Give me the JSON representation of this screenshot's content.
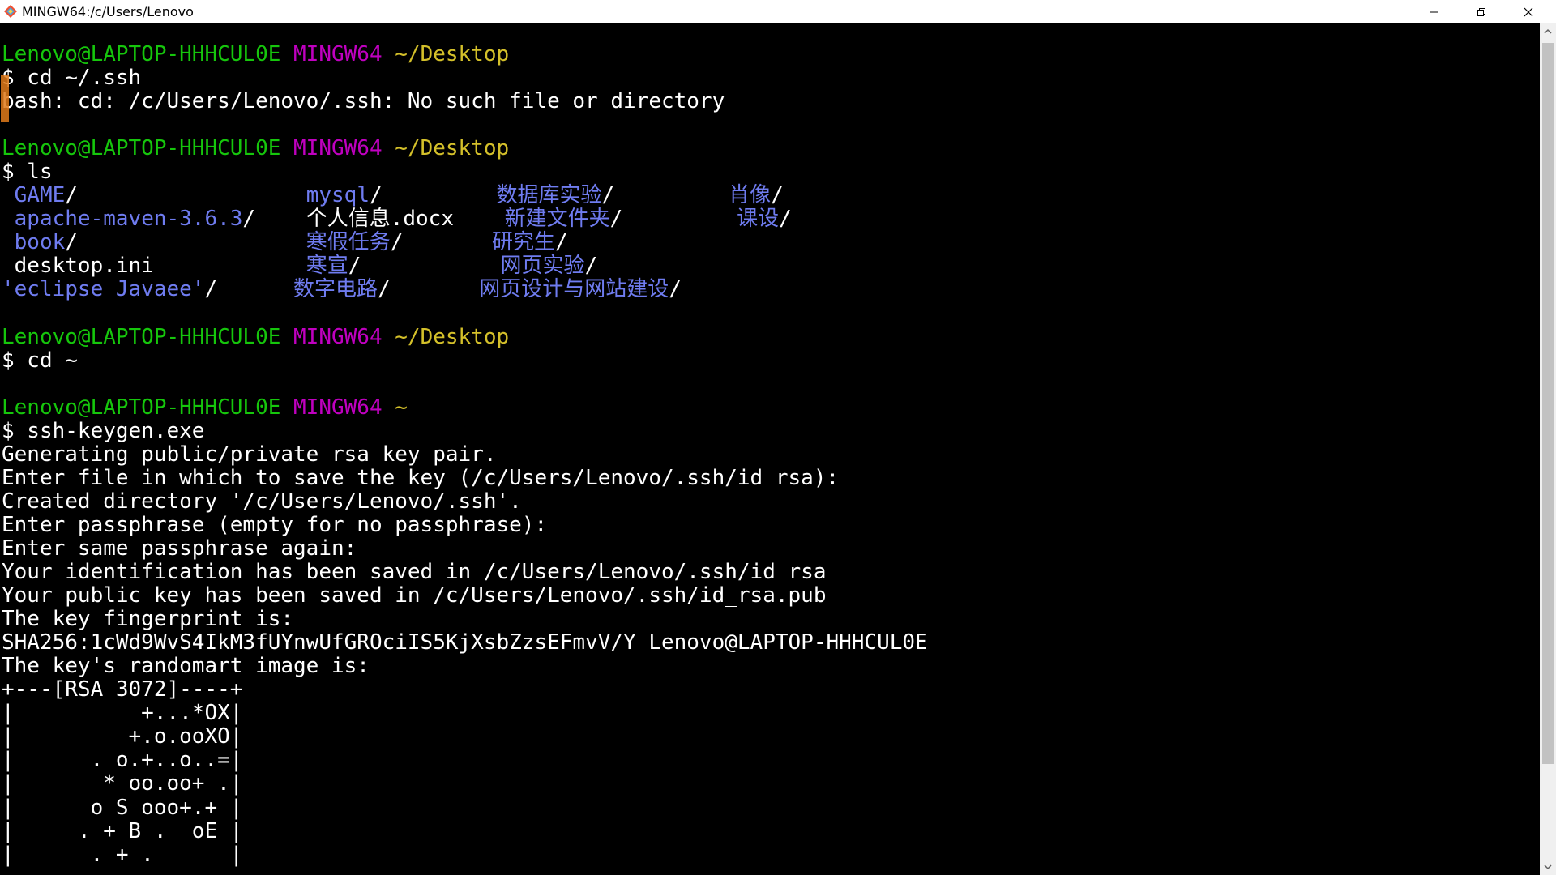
{
  "window": {
    "title": "MINGW64:/c/Users/Lenovo"
  },
  "icons": {
    "app": "git-bash-icon",
    "minimize": "minimize-icon",
    "maximize": "restore-icon",
    "close": "close-icon"
  },
  "colors": {
    "prompt_user": "#16c60c",
    "prompt_env": "#c000c0",
    "prompt_path": "#d4c02a",
    "directory": "#6f7cf0",
    "text": "#ffffff",
    "background": "#000000"
  },
  "terminal": {
    "lines": [
      [
        {
          "t": "Lenovo@LAPTOP-HHHCUL0E",
          "c": "g"
        },
        {
          "t": " ",
          "c": "w"
        },
        {
          "t": "MINGW64",
          "c": "m"
        },
        {
          "t": " ",
          "c": "w"
        },
        {
          "t": "~/Desktop",
          "c": "y"
        }
      ],
      [
        {
          "t": "$ cd ~/.ssh",
          "c": "w"
        }
      ],
      [
        {
          "t": "bash: cd: /c/Users/Lenovo/.ssh: No such file or directory",
          "c": "w"
        }
      ],
      [
        {
          "t": "",
          "c": "w"
        }
      ],
      [
        {
          "t": "Lenovo@LAPTOP-HHHCUL0E",
          "c": "g"
        },
        {
          "t": " ",
          "c": "w"
        },
        {
          "t": "MINGW64",
          "c": "m"
        },
        {
          "t": " ",
          "c": "w"
        },
        {
          "t": "~/Desktop",
          "c": "y"
        }
      ],
      [
        {
          "t": "$ ls",
          "c": "w"
        }
      ],
      [
        {
          "t": " ",
          "c": "w"
        },
        {
          "t": "GAME",
          "c": "b"
        },
        {
          "t": "/                  ",
          "c": "w"
        },
        {
          "t": "mysql",
          "c": "b"
        },
        {
          "t": "/         ",
          "c": "w"
        },
        {
          "t": "数据库实验",
          "c": "b"
        },
        {
          "t": "/         ",
          "c": "w"
        },
        {
          "t": "肖像",
          "c": "b"
        },
        {
          "t": "/",
          "c": "w"
        }
      ],
      [
        {
          "t": " ",
          "c": "w"
        },
        {
          "t": "apache-maven-3.6.3",
          "c": "b"
        },
        {
          "t": "/    ",
          "c": "w"
        },
        {
          "t": "个人信息.docx    ",
          "c": "w"
        },
        {
          "t": "新建文件夹",
          "c": "b"
        },
        {
          "t": "/         ",
          "c": "w"
        },
        {
          "t": "课设",
          "c": "b"
        },
        {
          "t": "/",
          "c": "w"
        }
      ],
      [
        {
          "t": " ",
          "c": "w"
        },
        {
          "t": "book",
          "c": "b"
        },
        {
          "t": "/                  ",
          "c": "w"
        },
        {
          "t": "寒假任务",
          "c": "b"
        },
        {
          "t": "/       ",
          "c": "w"
        },
        {
          "t": "研究生",
          "c": "b"
        },
        {
          "t": "/",
          "c": "w"
        }
      ],
      [
        {
          "t": " desktop.ini            ",
          "c": "w"
        },
        {
          "t": "寒宣",
          "c": "b"
        },
        {
          "t": "/           ",
          "c": "w"
        },
        {
          "t": "网页实验",
          "c": "b"
        },
        {
          "t": "/",
          "c": "w"
        }
      ],
      [
        {
          "t": "'eclipse Javaee'",
          "c": "b"
        },
        {
          "t": "/      ",
          "c": "w"
        },
        {
          "t": "数字电路",
          "c": "b"
        },
        {
          "t": "/       ",
          "c": "w"
        },
        {
          "t": "网页设计与网站建设",
          "c": "b"
        },
        {
          "t": "/",
          "c": "w"
        }
      ],
      [
        {
          "t": "",
          "c": "w"
        }
      ],
      [
        {
          "t": "Lenovo@LAPTOP-HHHCUL0E",
          "c": "g"
        },
        {
          "t": " ",
          "c": "w"
        },
        {
          "t": "MINGW64",
          "c": "m"
        },
        {
          "t": " ",
          "c": "w"
        },
        {
          "t": "~/Desktop",
          "c": "y"
        }
      ],
      [
        {
          "t": "$ cd ~",
          "c": "w"
        }
      ],
      [
        {
          "t": "",
          "c": "w"
        }
      ],
      [
        {
          "t": "Lenovo@LAPTOP-HHHCUL0E",
          "c": "g"
        },
        {
          "t": " ",
          "c": "w"
        },
        {
          "t": "MINGW64",
          "c": "m"
        },
        {
          "t": " ",
          "c": "w"
        },
        {
          "t": "~",
          "c": "y"
        }
      ],
      [
        {
          "t": "$ ssh-keygen.exe",
          "c": "w"
        }
      ],
      [
        {
          "t": "Generating public/private rsa key pair.",
          "c": "w"
        }
      ],
      [
        {
          "t": "Enter file in which to save the key (/c/Users/Lenovo/.ssh/id_rsa):",
          "c": "w"
        }
      ],
      [
        {
          "t": "Created directory '/c/Users/Lenovo/.ssh'.",
          "c": "w"
        }
      ],
      [
        {
          "t": "Enter passphrase (empty for no passphrase):",
          "c": "w"
        }
      ],
      [
        {
          "t": "Enter same passphrase again:",
          "c": "w"
        }
      ],
      [
        {
          "t": "Your identification has been saved in /c/Users/Lenovo/.ssh/id_rsa",
          "c": "w"
        }
      ],
      [
        {
          "t": "Your public key has been saved in /c/Users/Lenovo/.ssh/id_rsa.pub",
          "c": "w"
        }
      ],
      [
        {
          "t": "The key fingerprint is:",
          "c": "w"
        }
      ],
      [
        {
          "t": "SHA256:1cWd9WvS4IkM3fUYnwUfGROciIS5KjXsbZzsEFmvV/Y Lenovo@LAPTOP-HHHCUL0E",
          "c": "w"
        }
      ],
      [
        {
          "t": "The key's randomart image is:",
          "c": "w"
        }
      ],
      [
        {
          "t": "+---[RSA 3072]----+",
          "c": "w"
        }
      ],
      [
        {
          "t": "|          +...*OX|",
          "c": "w"
        }
      ],
      [
        {
          "t": "|         +.o.ooXO|",
          "c": "w"
        }
      ],
      [
        {
          "t": "|      . o.+..o..=|",
          "c": "w"
        }
      ],
      [
        {
          "t": "|       * oo.oo+ .|",
          "c": "w"
        }
      ],
      [
        {
          "t": "|      o S ooo+.+ |",
          "c": "w"
        }
      ],
      [
        {
          "t": "|     . + B .  oE |",
          "c": "w"
        }
      ],
      [
        {
          "t": "|      . + .      |",
          "c": "w"
        }
      ]
    ]
  }
}
